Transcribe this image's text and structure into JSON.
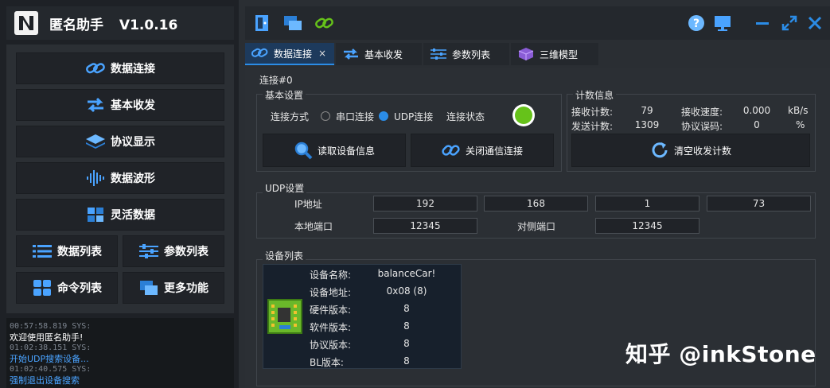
{
  "app": {
    "title": "匿名助手",
    "version": "V1.0.16"
  },
  "nav": {
    "data_connect": "数据连接",
    "basic_io": "基本收发",
    "protocol_display": "协议显示",
    "data_wave": "数据波形",
    "flex_data": "灵活数据",
    "data_list": "数据列表",
    "param_list": "参数列表",
    "command_list": "命令列表",
    "more": "更多功能"
  },
  "log": [
    {
      "ts": "00:57:58.819 SYS:",
      "msg": "欢迎使用匿名助手!",
      "color": "white"
    },
    {
      "ts": "01:02:38.151 SYS:",
      "msg": "开始UDP搜索设备...",
      "color": "blue"
    },
    {
      "ts": "01:02:40.575 SYS:",
      "msg": "强制退出设备搜索",
      "color": "blue"
    }
  ],
  "tabs": {
    "t1": "数据连接",
    "t2": "基本收发",
    "t3": "参数列表",
    "t4": "三维模型",
    "close": "×"
  },
  "connection": {
    "title": "连接#0",
    "basic_settings": "基本设置",
    "method_label": "连接方式",
    "serial": "串口连接",
    "udp": "UDP连接",
    "status_label": "连接状态",
    "status_color": "#66c21a",
    "read_info_btn": "读取设备信息",
    "close_conn_btn": "关闭通信连接"
  },
  "counters": {
    "title": "计数信息",
    "recv_count_label": "接收计数:",
    "recv_count": "79",
    "recv_speed_label": "接收速度:",
    "recv_speed": "0.000",
    "recv_speed_unit": "kB/s",
    "send_count_label": "发送计数:",
    "send_count": "1309",
    "err_label": "协议误码:",
    "err": "0",
    "err_unit": "%",
    "clear_btn": "清空收发计数"
  },
  "udp": {
    "title": "UDP设置",
    "ip_label": "IP地址",
    "ip1": "192",
    "ip2": "168",
    "ip3": "1",
    "ip4": "73",
    "local_port_label": "本地端口",
    "local_port": "12345",
    "remote_port_label": "对侧端口",
    "remote_port": "12345"
  },
  "devices": {
    "title": "设备列表",
    "name_label": "设备名称:",
    "name": "balanceCar!",
    "addr_label": "设备地址:",
    "addr": "0x08 (8)",
    "hw_label": "硬件版本:",
    "hw": "8",
    "sw_label": "软件版本:",
    "sw": "8",
    "proto_label": "协议版本:",
    "proto": "8",
    "bl_label": "BL版本:",
    "bl": "8"
  },
  "watermark": "知乎 @inkStone",
  "colors": {
    "accent": "#2b8ce6",
    "bg": "#2b2f34",
    "panel": "#202328"
  }
}
